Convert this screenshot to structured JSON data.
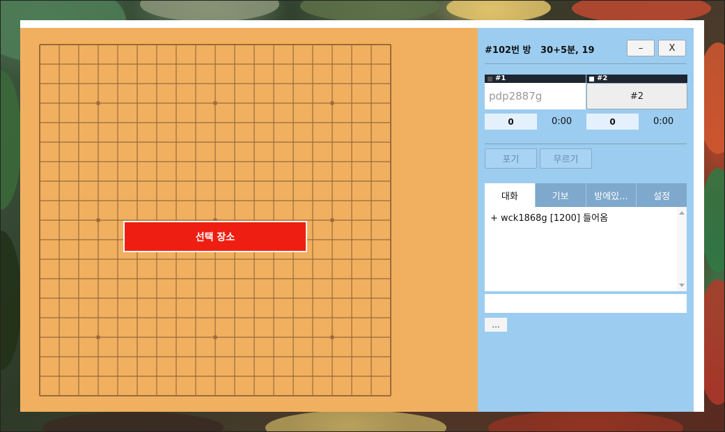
{
  "room": {
    "title": "#102번 방   30+5분, 19"
  },
  "window": {
    "minimize_label": "–",
    "close_label": "X"
  },
  "board": {
    "size": 19,
    "star_points": [
      3,
      9,
      15
    ],
    "line_color": "#9a6a3a",
    "board_color": "#f1b060"
  },
  "banner": {
    "label": "선택 장소"
  },
  "players": [
    {
      "tag": "#1",
      "name": "pdp2887g",
      "score": "0",
      "time": "0:00",
      "stone_color": "#555555"
    },
    {
      "tag": "#2",
      "name": "#2",
      "score": "0",
      "time": "0:00",
      "stone_color": "#ffffff"
    }
  ],
  "actions": {
    "resign_label": "포기",
    "undo_label": "무르기"
  },
  "tabs": [
    {
      "label": "대화",
      "active": true
    },
    {
      "label": "기보",
      "active": false
    },
    {
      "label": "방에있...",
      "active": false
    },
    {
      "label": "설정",
      "active": false
    }
  ],
  "chat": {
    "lines": [
      "+ wck1868g [1200] 들어옴"
    ]
  },
  "chat_input": {
    "value": ""
  },
  "more_button": {
    "label": "..."
  }
}
